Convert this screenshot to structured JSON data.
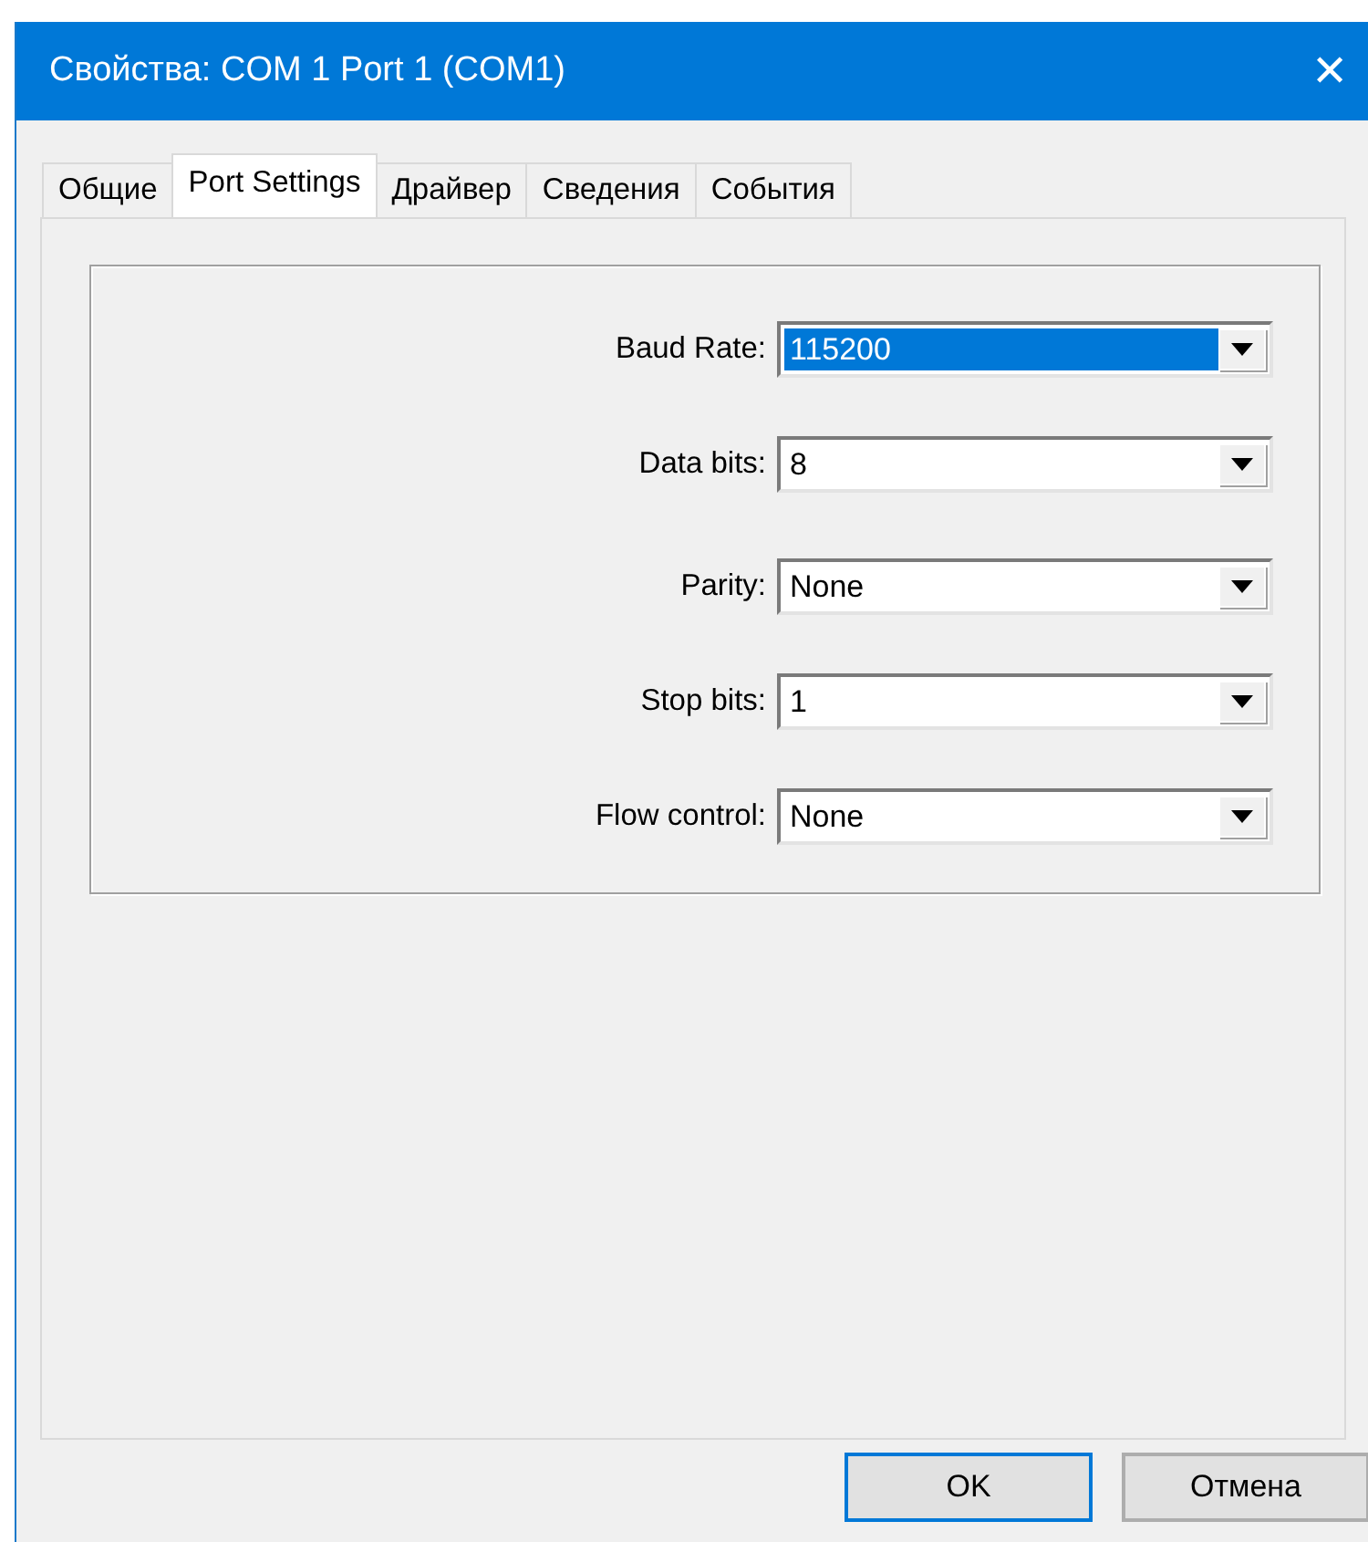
{
  "window": {
    "title": "Свойства: COM 1 Port 1 (COM1)",
    "close": "✕"
  },
  "tabs": [
    {
      "label": "Общие",
      "selected": false
    },
    {
      "label": "Port Settings",
      "selected": true
    },
    {
      "label": "Драйвер",
      "selected": false
    },
    {
      "label": "Сведения",
      "selected": false
    },
    {
      "label": "События",
      "selected": false
    }
  ],
  "fields": [
    {
      "label": "Baud Rate:",
      "value": "115200",
      "highlighted": true
    },
    {
      "label": "Data bits:",
      "value": "8",
      "highlighted": false
    },
    {
      "label": "Parity:",
      "value": "None",
      "highlighted": false
    },
    {
      "label": "Stop bits:",
      "value": "1",
      "highlighted": false
    },
    {
      "label": "Flow control:",
      "value": "None",
      "highlighted": false
    }
  ],
  "buttons": [
    {
      "label": "OK",
      "default": true
    },
    {
      "label": "Отмена",
      "default": false
    }
  ]
}
